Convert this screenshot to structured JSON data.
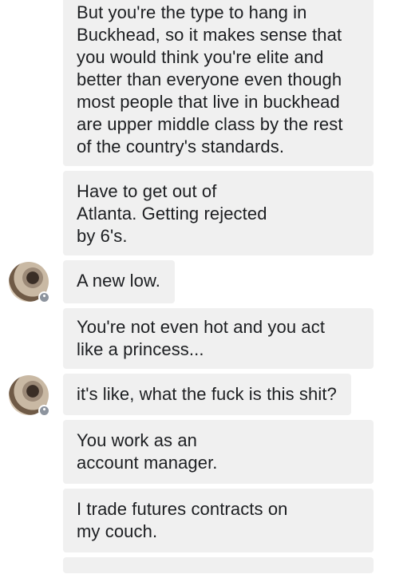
{
  "messages": [
    {
      "text": "But you're the type to hang in\nBuckhead, so it makes sense that\nyou would think you're elite and\nbetter than everyone even though\nmost people that live in buckhead\nare upper middle class by the rest\nof the country's standards.",
      "avatar": false
    },
    {
      "text": "Have to get out of\nAtlanta.  Getting rejected\nby 6's.",
      "avatar": false
    },
    {
      "text": "A new low.",
      "avatar": true
    },
    {
      "text": "You're not even hot and you act\nlike a princess...",
      "avatar": false
    },
    {
      "text": "it's like, what the fuck is this shit?",
      "avatar": true
    },
    {
      "text": "You work as an\naccount manager.",
      "avatar": false
    },
    {
      "text": "I trade futures contracts on\nmy couch.",
      "avatar": false
    }
  ],
  "avatar_badge_icon": "messenger-badge-icon",
  "colors": {
    "bubble": "#f0f0f0",
    "text": "#1c1e21",
    "background": "#ffffff"
  }
}
